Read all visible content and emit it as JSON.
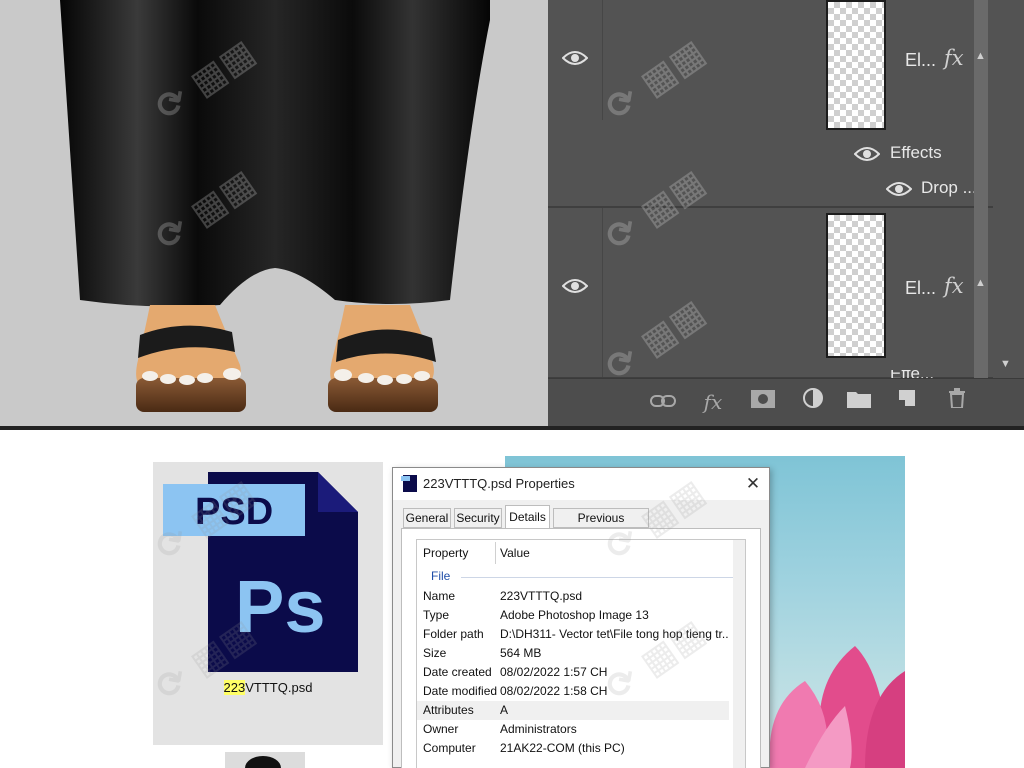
{
  "photoshop": {
    "layers": [
      {
        "name": "El...",
        "has_fx": true,
        "effects_label": "Effects",
        "effect_item": "Drop ..."
      },
      {
        "name": "El...",
        "has_fx": true,
        "effects_label": "Effe..."
      }
    ],
    "footer_icons": [
      "link-layers-icon",
      "fx-icon",
      "layer-mask-icon",
      "adjustment-layer-icon",
      "folder-icon",
      "new-layer-icon",
      "trash-icon"
    ],
    "fx_symbol": "fx"
  },
  "explorer": {
    "file_caption_highlight": "223",
    "file_caption_rest": "VTTTQ.psd",
    "psd_badge": "PSD",
    "ps_logo": "Ps"
  },
  "dialog": {
    "title": "223VTTTQ.psd Properties",
    "close_symbol": "✕",
    "tabs": [
      "General",
      "Security",
      "Details",
      "Previous Versions"
    ],
    "active_tab": "Details",
    "columns": {
      "property": "Property",
      "value": "Value"
    },
    "group": "File",
    "rows": [
      {
        "name": "Name",
        "value": "223VTTTQ.psd"
      },
      {
        "name": "Type",
        "value": "Adobe Photoshop Image 13"
      },
      {
        "name": "Folder path",
        "value": "D:\\DH311- Vector tet\\File tong hop tieng tr..."
      },
      {
        "name": "Size",
        "value": "564 MB"
      },
      {
        "name": "Date created",
        "value": "08/02/2022 1:57 CH"
      },
      {
        "name": "Date modified",
        "value": "08/02/2022 1:58 CH"
      },
      {
        "name": "Attributes",
        "value": "A"
      },
      {
        "name": "Owner",
        "value": "Administrators"
      },
      {
        "name": "Computer",
        "value": "21AK22-COM (this PC)"
      }
    ]
  },
  "colors": {
    "ps_panel": "#535353",
    "canvas_bg": "#c9c9c9",
    "group_label": "#1f4ea8",
    "psd_blue": "#0b0b4a",
    "psd_light": "#8cc4f2"
  }
}
